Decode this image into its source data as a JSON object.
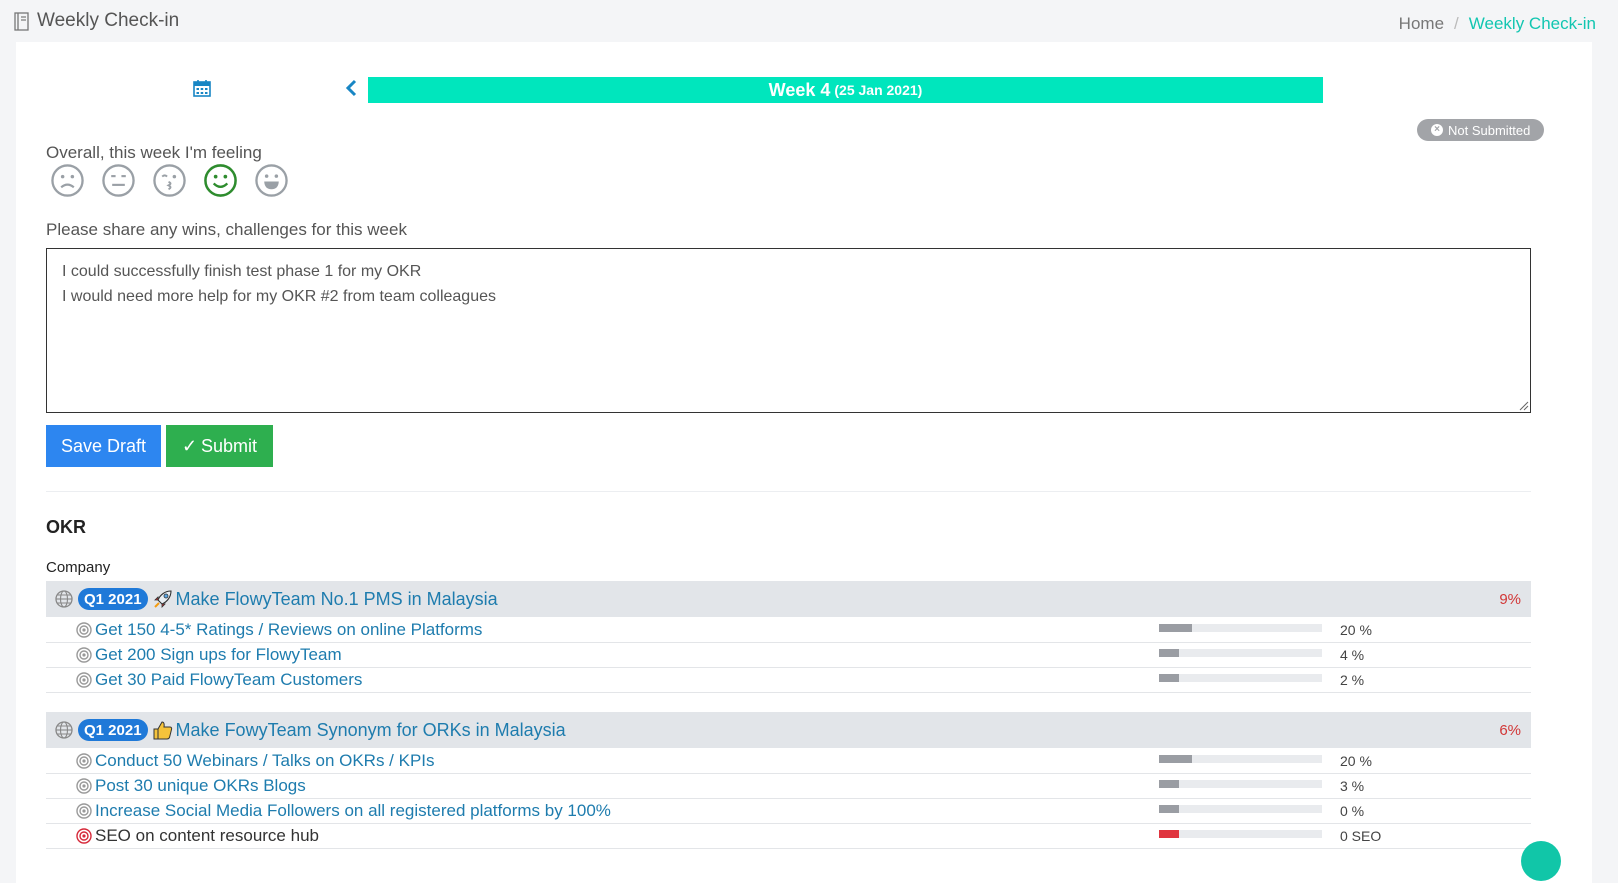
{
  "header": {
    "title": "Weekly Check-in",
    "breadcrumb": {
      "home": "Home",
      "separator": "/",
      "current": "Weekly Check-in"
    }
  },
  "week": {
    "label": "Week 4",
    "date": "(25 Jan 2021)"
  },
  "status": {
    "label": "Not Submitted"
  },
  "feeling": {
    "label": "Overall, this week I'm feeling",
    "moods": [
      "sad",
      "neutral",
      "kiss",
      "happy",
      "grin"
    ],
    "selected": "happy"
  },
  "wins": {
    "label": "Please share any wins, challenges for this week",
    "value": "I could successfully finish test phase 1 for my OKR\nI would need more help for my OKR #2 from team colleagues"
  },
  "buttons": {
    "save_draft": "Save Draft",
    "submit_check": "✓",
    "submit": "Submit"
  },
  "okr": {
    "heading": "OKR",
    "group": "Company",
    "objectives": [
      {
        "quarter": "Q1 2021",
        "icon": "rocket-icon",
        "title": "Make FlowyTeam No.1 PMS in Malaysia",
        "progress": "9%",
        "key_results": [
          {
            "title": "Get 150 4-5* Ratings / Reviews on online Platforms",
            "value": "20 %",
            "progress": 0.2,
            "status": "normal"
          },
          {
            "title": "Get 200 Sign ups for FlowyTeam",
            "value": "4 %",
            "progress": 0.12,
            "status": "normal"
          },
          {
            "title": "Get 30 Paid FlowyTeam Customers",
            "value": "2 %",
            "progress": 0.12,
            "status": "normal"
          }
        ]
      },
      {
        "quarter": "Q1 2021",
        "icon": "thumbs-up-icon",
        "title": "Make FowyTeam Synonym for ORKs in Malaysia",
        "progress": "6%",
        "key_results": [
          {
            "title": "Conduct 50 Webinars / Talks on OKRs / KPIs",
            "value": "20 %",
            "progress": 0.2,
            "status": "normal"
          },
          {
            "title": "Post 30 unique OKRs Blogs",
            "value": "3 %",
            "progress": 0.12,
            "status": "normal"
          },
          {
            "title": "Increase Social Media Followers on all registered platforms by 100%",
            "value": "0 %",
            "progress": 0.12,
            "status": "normal"
          },
          {
            "title": "SEO on content resource hub",
            "value": "0 SEO",
            "progress": 0.12,
            "status": "alert"
          }
        ]
      }
    ]
  },
  "colors": {
    "accent": "#00e6bd",
    "link": "#1e7cae",
    "primary": "#2d86f0",
    "success": "#2eaf4f",
    "danger": "#d23636"
  }
}
